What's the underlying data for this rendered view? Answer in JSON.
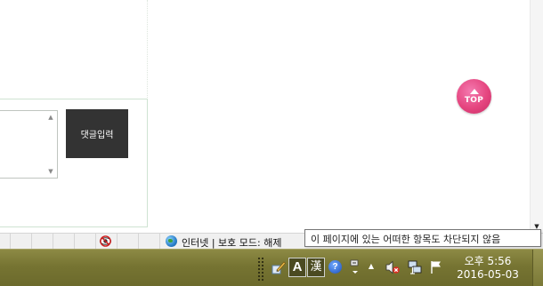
{
  "content": {
    "comment_submit_label": "댓글입력",
    "top_button_label": "TOP"
  },
  "status_bar": {
    "zone_text": "인터넷 | 보호 모드: 해제",
    "tooltip": "이 페이지에 있는 어떠한 항목도 차단되지 않음"
  },
  "taskbar": {
    "ime_mode": "A",
    "ime_hanja": "漢",
    "help_glyph": "?",
    "clock_time": "오후 5:56",
    "clock_date": "2016-05-03"
  },
  "colors": {
    "top_button": "#e5457f",
    "taskbar": "#767432",
    "comment_button": "#333333"
  },
  "icons": [
    "privacy-report-icon",
    "internet-zone-globe-icon",
    "ime-pen-icon",
    "help-icon",
    "ime-menu-icon",
    "tray-expand-icon",
    "volume-muted-icon",
    "network-icon",
    "action-center-flag-icon"
  ]
}
